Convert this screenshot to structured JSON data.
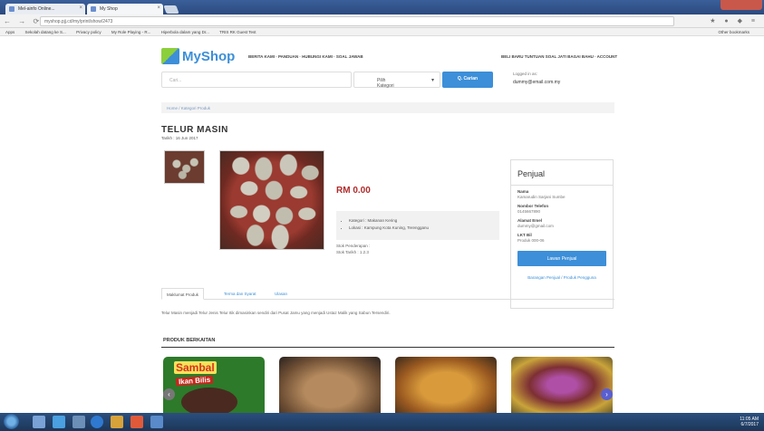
{
  "browser": {
    "tab1_title": "Mel-ainfo Online...",
    "tab2_title": "My Shop",
    "url": "myshop.pjj.cd/my/print/show/2473",
    "bookmarks": [
      "Apps",
      "Sekolah datang ke S...",
      "Privacy policy",
      "My Role Playing - R...",
      "Hiperbola dalam yang Dr...",
      "TRIS RK Guest Test"
    ],
    "other_bookmarks": "Other bookmarks"
  },
  "site": {
    "logo": "MyShop",
    "nav": "BERITA KAMI · PANDUAN · HUBUNGI KAMI · SOAL JAWAB",
    "account": "BELI BARU TUNTUAN SOAL JATI BAGAI BAHU · ACCOUNT"
  },
  "search": {
    "placeholder": "Cari...",
    "category": "Pilih Kategori",
    "button": "Q. Carian",
    "logged_in_label": "Logged in as:",
    "email": "dummy@email.com.my"
  },
  "breadcrumb": "Home / Kategori Produk",
  "product": {
    "title": "TELUR MASIN",
    "date": "Tarikh : 16 Jun 2017",
    "price": "RM 0.00",
    "details": [
      "Kategori : Makanan Kering",
      "Lokasi : Kampung Kota Kuning, Terengganu"
    ],
    "stock_label": "Stok Penderapan :",
    "stock_value": "Stok Tarikh : 1.2.3"
  },
  "seller": {
    "heading": "Penjual",
    "fields": [
      {
        "label": "Nama",
        "value": "Kamarudin Sarjani Sumbe"
      },
      {
        "label": "Nombor Telefon",
        "value": "0145667890"
      },
      {
        "label": "Alamat Emel",
        "value": "dummy@gmail.com"
      },
      {
        "label": "LKT Bil",
        "value": "Produk 000-06"
      }
    ],
    "contact_button": "Lawan Penjual",
    "other_link": "Barangan Penjual / Produk Pengguna"
  },
  "tabs": [
    "Maklumat Produk",
    "Terma dan Syarat",
    "Ulasan"
  ],
  "description": "Telur Masin menjadi Telur Jenis Telur Itik dimasinkan sendiri dari Pusat Jamu yang menjadi Ustaz Malik yang Sabun Tersendiri.",
  "related": {
    "heading": "PRODUK BERKAITAN",
    "brand_line1": "Sambal",
    "brand_line2": "Ikan Bilis"
  },
  "taskbar": {
    "time": "11:05 AM",
    "date": "6/7/2017"
  }
}
